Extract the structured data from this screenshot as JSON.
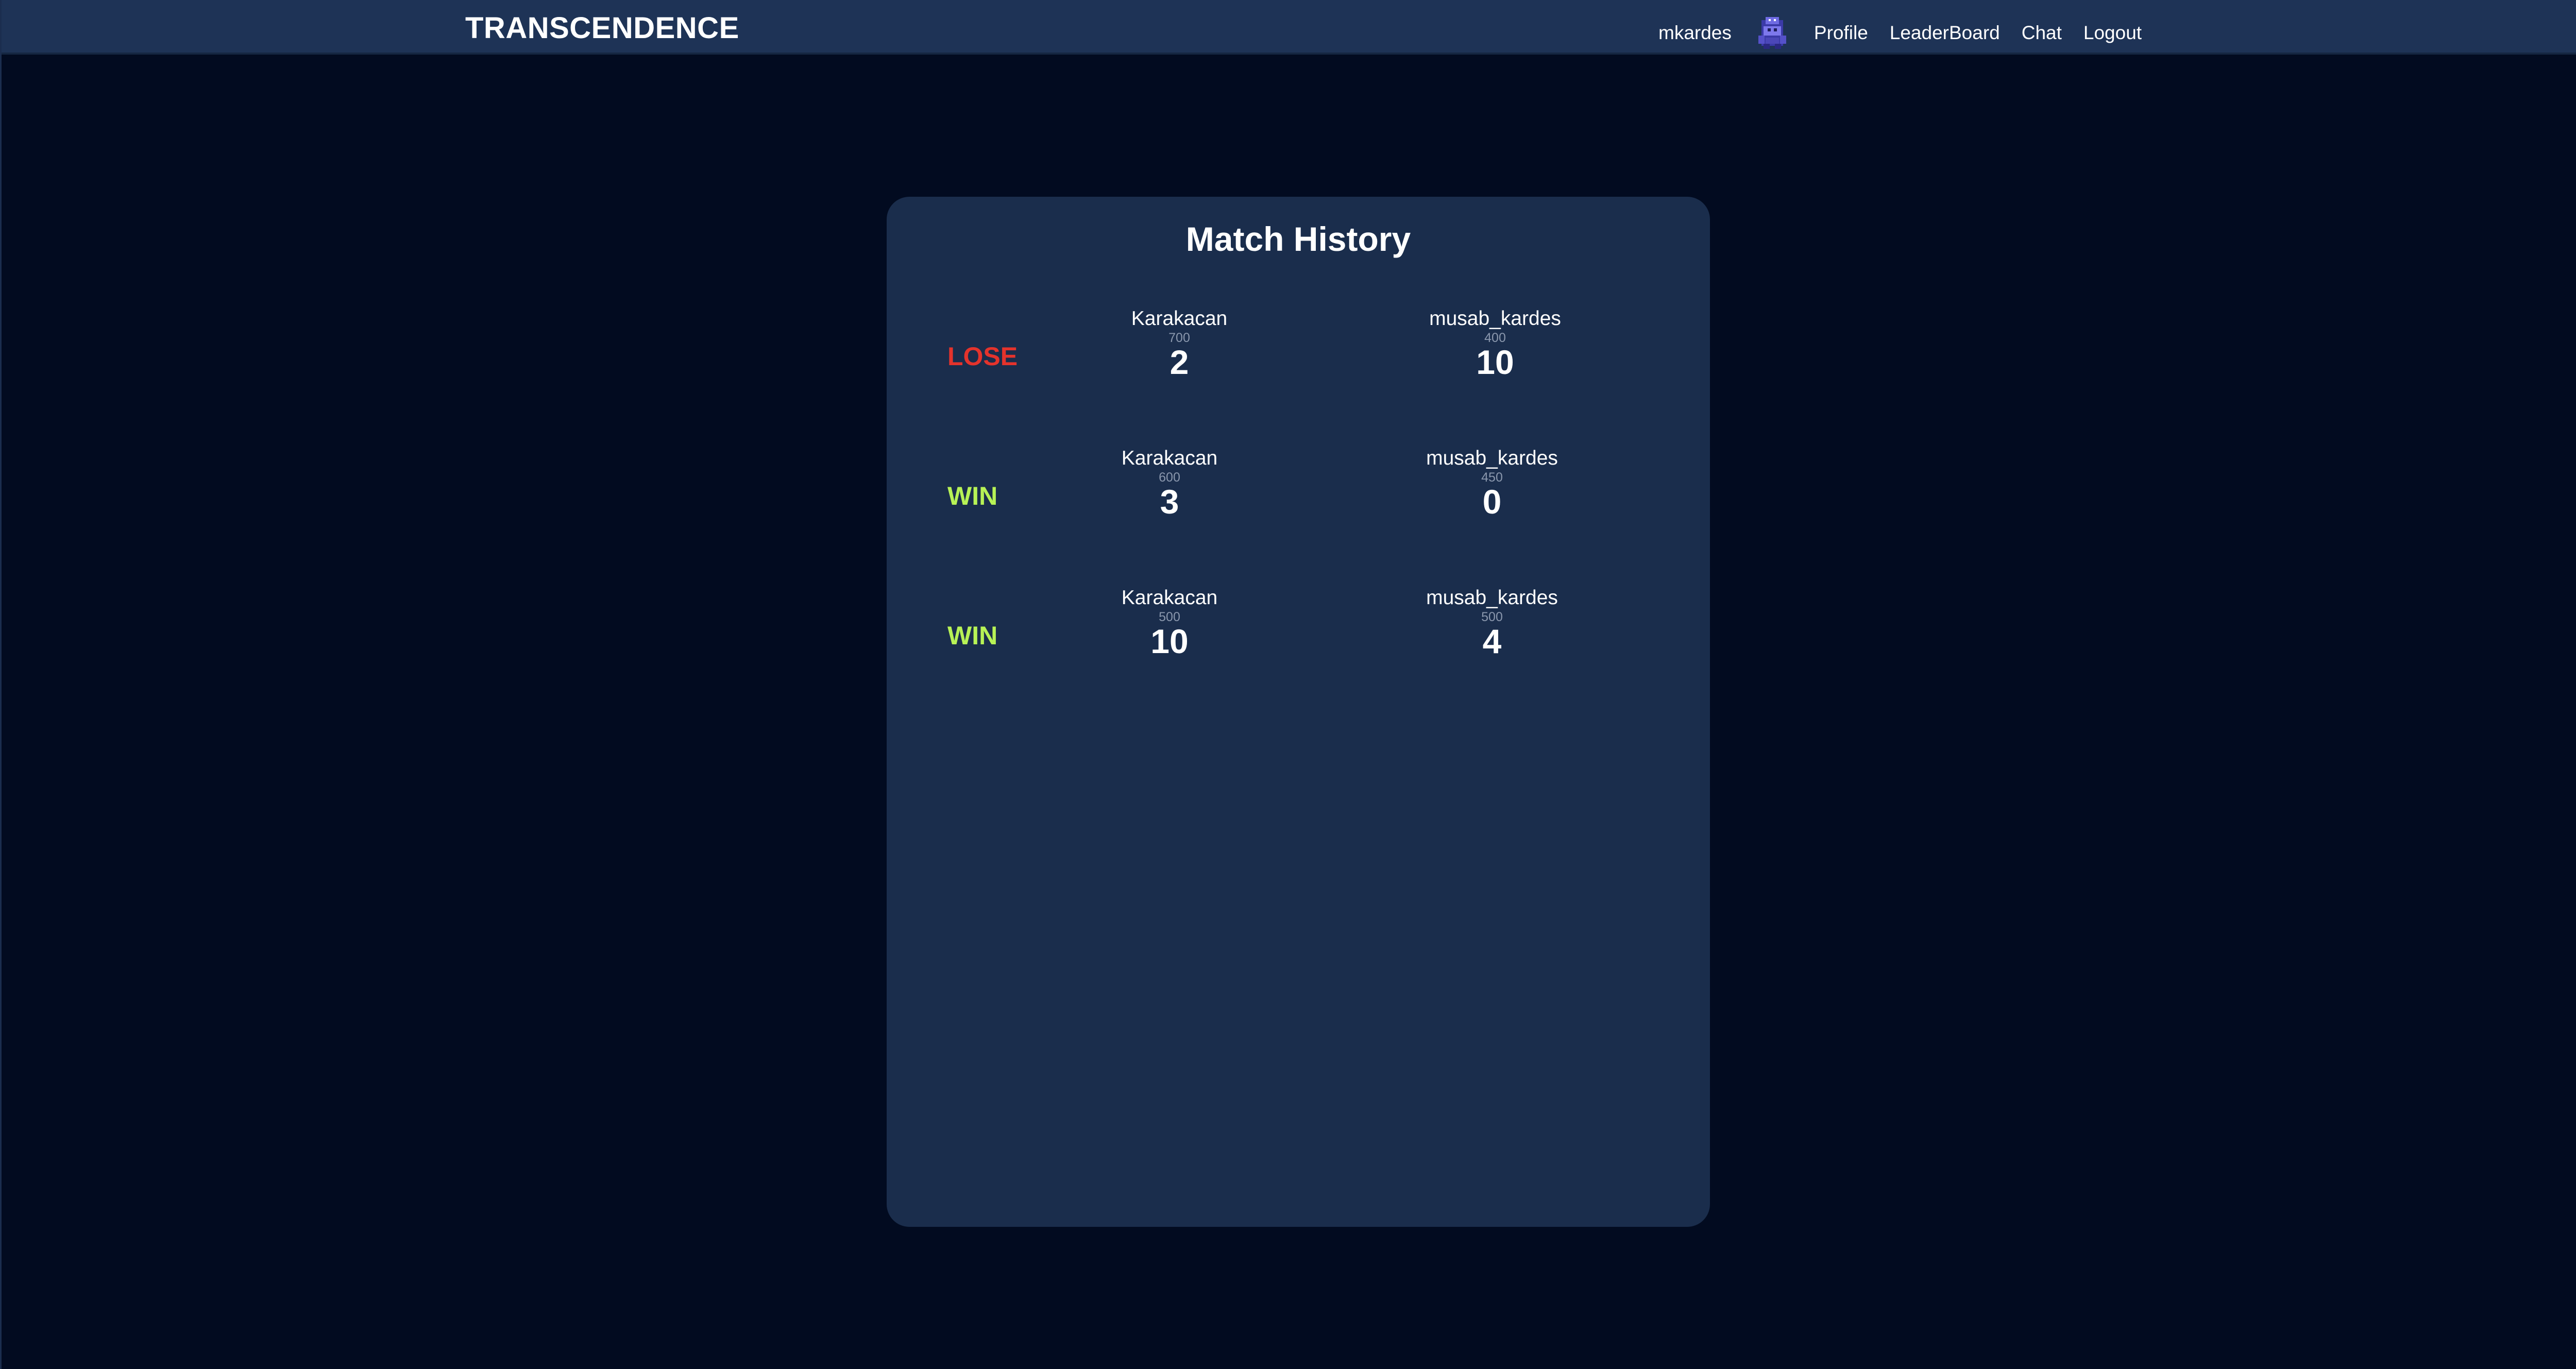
{
  "navbar": {
    "brand": "TRANSCENDENCE",
    "username": "mkardes",
    "avatar_icon": "pixel-character-icon",
    "links": [
      "Profile",
      "LeaderBoard",
      "Chat",
      "Logout"
    ]
  },
  "colors": {
    "background": "#020b20",
    "navbar": "#1e3356",
    "card": "#1a2d4c",
    "lose": "#e4332c",
    "win": "#b7f256"
  },
  "match_history": {
    "title": "Match History",
    "matches": [
      {
        "result": "LOSE",
        "player1": {
          "name": "Karakacan",
          "rating": "700",
          "score": "2"
        },
        "player2": {
          "name": "musab_kardes",
          "rating": "400",
          "score": "10"
        }
      },
      {
        "result": "WIN",
        "player1": {
          "name": "Karakacan",
          "rating": "600",
          "score": "3"
        },
        "player2": {
          "name": "musab_kardes",
          "rating": "450",
          "score": "0"
        }
      },
      {
        "result": "WIN",
        "player1": {
          "name": "Karakacan",
          "rating": "500",
          "score": "10"
        },
        "player2": {
          "name": "musab_kardes",
          "rating": "500",
          "score": "4"
        }
      }
    ]
  }
}
